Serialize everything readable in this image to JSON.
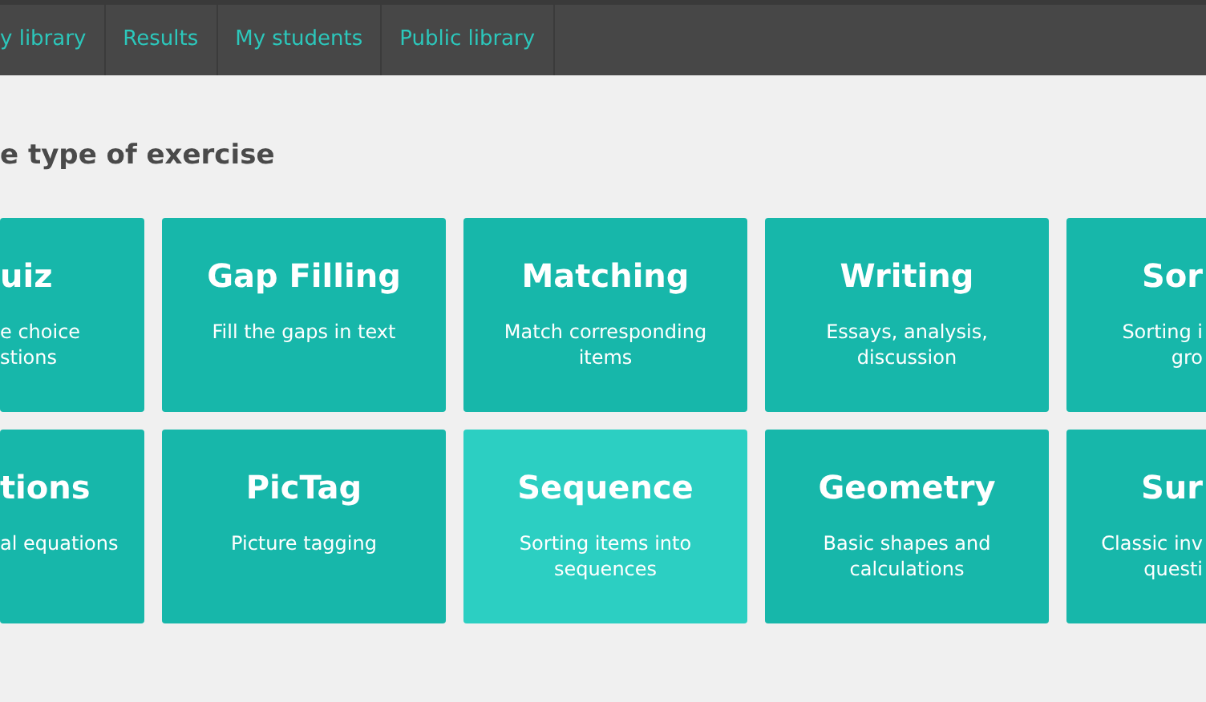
{
  "nav": {
    "items": [
      "y library",
      "Results",
      "My students",
      "Public library"
    ]
  },
  "heading": "e type of exercise",
  "rows": [
    {
      "cards": [
        {
          "kind": "cut_left",
          "title": "uiz",
          "description": "e choice\nstions",
          "selected": false
        },
        {
          "kind": "full",
          "title": "Gap Filling",
          "description": "Fill the gaps in text",
          "selected": false
        },
        {
          "kind": "full",
          "title": "Matching",
          "description": "Match corresponding items",
          "selected": false
        },
        {
          "kind": "full",
          "title": "Writing",
          "description": "Essays, analysis, discussion",
          "selected": false
        },
        {
          "kind": "cut_right",
          "title": "Sor",
          "description": "Sorting i\ngro",
          "selected": false
        }
      ]
    },
    {
      "cards": [
        {
          "kind": "cut_left",
          "title": "tions",
          "description": "al equations",
          "selected": false
        },
        {
          "kind": "full",
          "title": "PicTag",
          "description": "Picture tagging",
          "selected": false
        },
        {
          "kind": "full",
          "title": "Sequence",
          "description": "Sorting items into sequences",
          "selected": true
        },
        {
          "kind": "full",
          "title": "Geometry",
          "description": "Basic shapes and calculations",
          "selected": false
        },
        {
          "kind": "cut_right",
          "title": "Sur",
          "description": "Classic inv\nquesti",
          "selected": false
        }
      ]
    }
  ]
}
